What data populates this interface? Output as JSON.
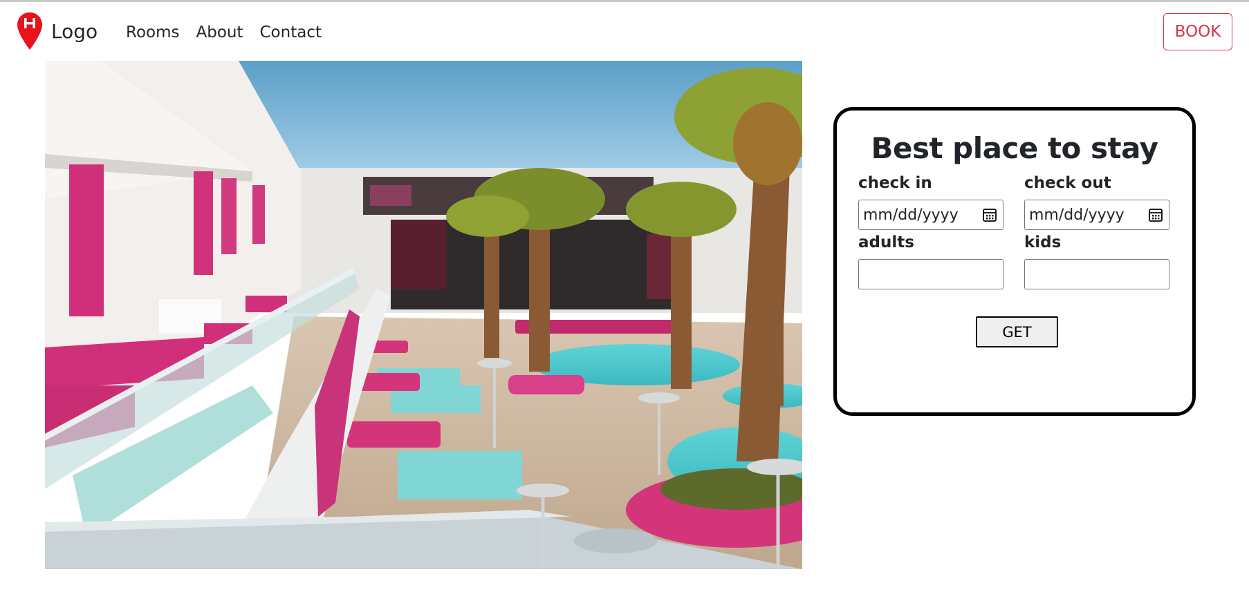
{
  "navbar": {
    "brand_text": "Logo",
    "brand_icon": "location-pin-h-icon",
    "links": [
      "Rooms",
      "About",
      "Contact"
    ],
    "book_label": "BOOK",
    "accent_color": "#dc3545"
  },
  "hero": {
    "image_alt": "hotel pool terrace with palm trees and pink cabanas"
  },
  "booking": {
    "title": "Best place to stay",
    "check_in_label": "check in",
    "check_out_label": "check out",
    "adults_label": "adults",
    "kids_label": "kids",
    "date_placeholder": "mm/dd/yyyy",
    "adults_value": "",
    "kids_value": "",
    "get_label": "GET"
  }
}
